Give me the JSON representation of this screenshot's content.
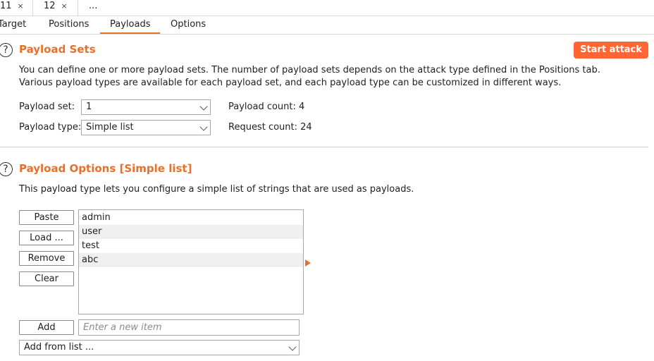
{
  "attack_tabs": [
    {
      "label": "11",
      "close": "×"
    },
    {
      "label": "12",
      "close": "×"
    },
    {
      "label": "..."
    }
  ],
  "sub_tabs": [
    "Target",
    "Positions",
    "Payloads",
    "Options"
  ],
  "active_sub_tab": "Payloads",
  "accent_color": "#e8702a",
  "start_button_color": "#ff6633",
  "payload_sets": {
    "title": "Payload Sets",
    "help_icon": "?",
    "start_attack_label": "Start attack",
    "description_line1": "You can define one or more payload sets. The number of payload sets depends on the attack type defined in the Positions tab.",
    "description_line2": "Various payload types are available for each payload set, and each payload type can be customized in different ways.",
    "payload_set_label": "Payload set:",
    "payload_set_value": "1",
    "payload_type_label": "Payload type:",
    "payload_type_value": "Simple list",
    "payload_count": "Payload count: 4",
    "request_count": "Request count: 24"
  },
  "payload_options": {
    "title": "Payload Options [Simple list]",
    "help_icon": "?",
    "description": "This payload type lets you configure a simple list of strings that are used as payloads.",
    "buttons": {
      "paste": "Paste",
      "load": "Load ...",
      "remove": "Remove",
      "clear": "Clear",
      "add": "Add"
    },
    "items": [
      "admin",
      "user",
      "test",
      "abc"
    ],
    "new_item_placeholder": "Enter a new item",
    "add_from_list": "Add from list ..."
  }
}
